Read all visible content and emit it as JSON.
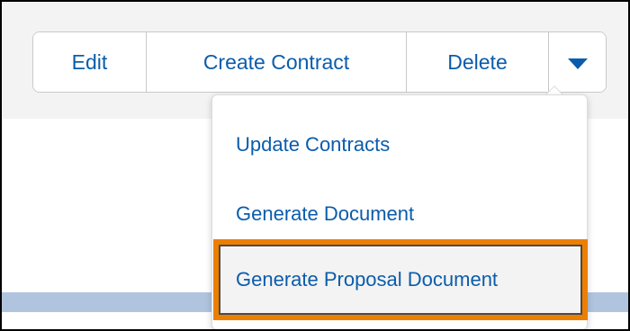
{
  "toolbar": {
    "edit_label": "Edit",
    "create_contract_label": "Create Contract",
    "delete_label": "Delete",
    "more_icon": "chevron-down-icon"
  },
  "dropdown_menu": {
    "items": [
      {
        "label": "Update Contracts"
      },
      {
        "label": "Generate Document"
      },
      {
        "label": "Generate Proposal Document",
        "highlighted": true
      }
    ]
  },
  "colors": {
    "accent": "#0b5cab",
    "highlight_border": "#ec7f00",
    "header_background": "#f3f3f3",
    "blue_strip": "#b0c4df"
  }
}
